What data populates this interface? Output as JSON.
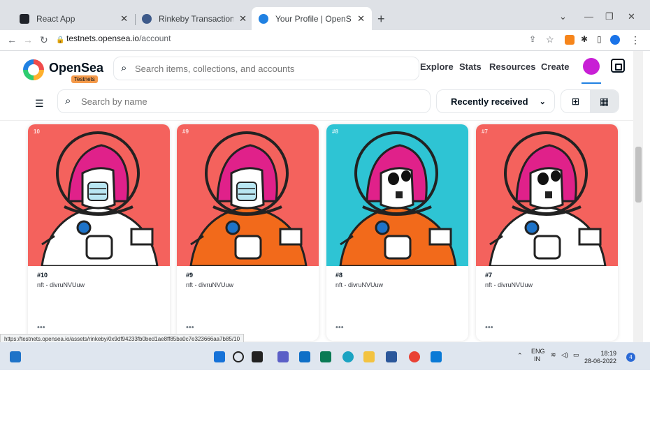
{
  "browser": {
    "tabs": [
      {
        "title": "React App",
        "color": "#20232a"
      },
      {
        "title": "Rinkeby Transaction Hash (Txhash)",
        "color": "#3d5a8a"
      },
      {
        "title": "Your Profile | OpenSea",
        "color": "#2081e2"
      }
    ],
    "url_host": "testnets.opensea.io",
    "url_path": "/account"
  },
  "header": {
    "brand": "OpenSea",
    "badge": "Testnets",
    "search_placeholder": "Search items, collections, and accounts",
    "nav": [
      "Explore",
      "Stats",
      "Resources",
      "Create"
    ]
  },
  "filters": {
    "search_placeholder": "Search by name",
    "sort_label": "Recently received"
  },
  "cards": [
    {
      "tag": "10",
      "title": "#10",
      "collection": "nft - divruNVUuw",
      "bg": "#f4625d",
      "suit": "#ffffff",
      "mask": true
    },
    {
      "tag": "#9",
      "title": "#9",
      "collection": "nft - divruNVUuw",
      "bg": "#f4625d",
      "suit": "#f26a1b",
      "mask": true
    },
    {
      "tag": "#8",
      "title": "#8",
      "collection": "nft - divruNVUuw",
      "bg": "#2ec4d4",
      "suit": "#f26a1b",
      "mask": false
    },
    {
      "tag": "#7",
      "title": "#7",
      "collection": "nft - divruNVUuw",
      "bg": "#f4625d",
      "suit": "#ffffff",
      "mask": false
    }
  ],
  "more_label": "•••",
  "status_url": "https://testnets.opensea.io/assets/rinkeby/0x9df94233fb0bed1ae8ff85ba0c7e323666aa7b85/10",
  "taskbar": {
    "lang_top": "ENG",
    "lang_bottom": "IN",
    "time": "18:19",
    "date": "28-06-2022",
    "notifications": "4"
  }
}
